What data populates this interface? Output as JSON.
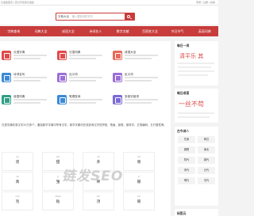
{
  "topbar": {
    "left_text": "汉语迷首页 | 查汉字就用汉语迷",
    "right_text": "登录 | 注册 | 投稿"
  },
  "search": {
    "type_label": "字典大全",
    "placeholder": "输入要查询的字词",
    "button_icon": "search-icon"
  },
  "nav": {
    "items": [
      "字典查询",
      "词典大全",
      "成语大全",
      "诗词名人",
      "数字文献",
      "百家姓大全",
      "节日节气",
      "英语词典"
    ]
  },
  "cards": [
    {
      "label": "汉语字典",
      "color": "#e14a4a",
      "icon": "book-icon"
    },
    {
      "label": "汉语词典",
      "color": "#e14a4a",
      "icon": "book-icon"
    },
    {
      "label": "成语大全",
      "color": "#e86a5a",
      "icon": "book-icon"
    },
    {
      "label": "诗词名句",
      "color": "#3a8ad6",
      "icon": "book-icon"
    },
    {
      "label": "近义词",
      "color": "#9b6fd6",
      "icon": "book-icon"
    },
    {
      "label": "反义词",
      "color": "#9b6fd6",
      "icon": "book-icon"
    },
    {
      "label": "谜语词典",
      "color": "#2f9f86",
      "icon": "book-icon"
    },
    {
      "label": "笔顺查询",
      "color": "#3a8ad6",
      "icon": "book-icon"
    },
    {
      "label": "多音字组词",
      "color": "#7c6ad6",
      "icon": "book-icon"
    }
  ],
  "description": "汉语字典收录汉字20万多个，囊括新华字典中所有汉字。新华字典可在线查询汉字的拼音、笔画、部首、繁体字、五笔编码、五行属性等。",
  "char_grid": [
    {
      "pinyin": "yù",
      "hanzi": "谣"
    },
    {
      "pinyin": "jiǎ",
      "hanzi": "甜"
    },
    {
      "pinyin": "mí",
      "hanzi": "荞"
    },
    {
      "pinyin": "chí",
      "hanzi": "喀"
    },
    {
      "pinyin": "yè",
      "hanzi": "禹"
    },
    {
      "pinyin": "jí",
      "hanzi": "雏"
    },
    {
      "pinyin": "tú",
      "hanzi": "稀"
    },
    {
      "pinyin": "jī",
      "hanzi": "辙"
    },
    {
      "pinyin": "cuò",
      "hanzi": "泡"
    },
    {
      "pinyin": "shǎo",
      "hanzi": "粘"
    },
    {
      "pinyin": "bó",
      "hanzi": "顶"
    },
    {
      "pinyin": "liù",
      "hanzi": "碴"
    }
  ],
  "sidebar": {
    "daily_word_title": "每日一词",
    "daily_word": "清平乐 其",
    "daily_idiom_title": "每日成语",
    "daily_idiom": "一丝不苟",
    "poetry_title": "古今诗人",
    "poets": [
      "先秦",
      "两汉",
      "魏晋",
      "南北",
      "隋代",
      "唐代",
      "宋代",
      "元代",
      "明代",
      "清代"
    ],
    "bottom_title": "标签云"
  },
  "watermark": "链发SEO"
}
